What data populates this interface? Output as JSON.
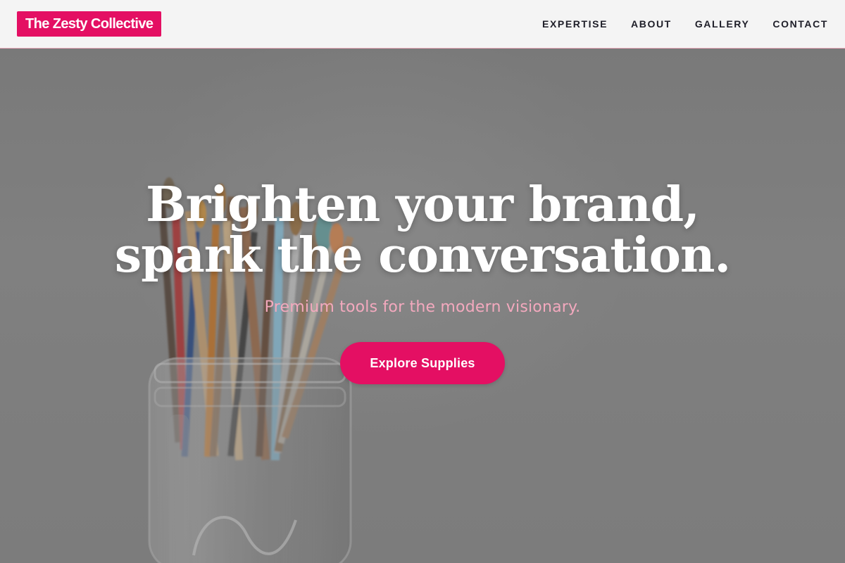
{
  "header": {
    "brand": "The Zesty Collective",
    "nav": [
      {
        "label": "EXPERTISE"
      },
      {
        "label": "ABOUT"
      },
      {
        "label": "GALLERY"
      },
      {
        "label": "CONTACT"
      }
    ]
  },
  "hero": {
    "title_line1": "Brighten your brand,",
    "title_line2": "spark the conversation.",
    "subtitle": "Premium tools for the modern visionary.",
    "cta_label": "Explore Supplies",
    "background_image": "paintbrushes-in-glass-jar"
  },
  "colors": {
    "accent": "#e40f63",
    "subtitle": "#f3a9be",
    "nav_background": "#f4f4f4",
    "nav_text": "#1e1e28",
    "hero_text": "#ffffff"
  }
}
